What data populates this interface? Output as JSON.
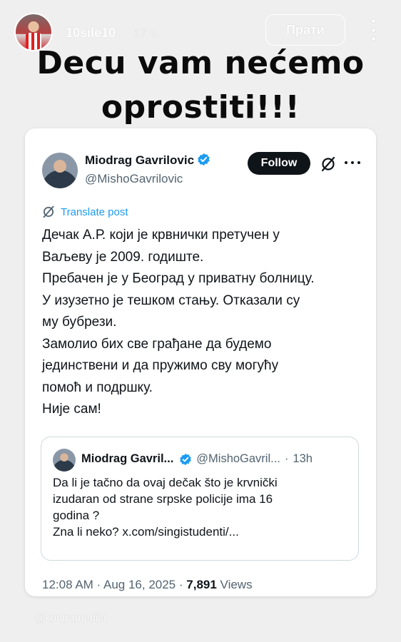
{
  "story": {
    "username": "10sile10",
    "time": "17 ч.",
    "follow_label": "Прати",
    "caption_line1": "Decu vam nećemo",
    "caption_line2": "oprostiti!!!",
    "watermark": "@kontramedija"
  },
  "tweet": {
    "author_name": "Miodrag Gavrilovic",
    "author_handle": "@MishoGavrilovic",
    "follow_label": "Follow",
    "translate_label": "Translate post",
    "body_lines": [
      "Дечак А.Р. који је крвнички претучен у",
      "Ваљеву је 2009. годиште.",
      "Пребачен је у Београд у приватну болницу.",
      "У изузетно је тешком стању. Отказали су",
      "му бубрези.",
      "Замолио бих све грађане да будемо",
      "јединствени и да пружимо сву могућу",
      "помоћ и подршку.",
      "Није сам!"
    ],
    "quote": {
      "name": "Miodrag Gavril...",
      "handle": "@MishoGavril...",
      "separator": "·",
      "time": "13h",
      "text_lines": [
        "Da li je tačno da ovaj dečak što je krvnički",
        "izudaran od strane srpske policije ima 16",
        "godina ?",
        "Zna li neko? x.com/singistudenti/..."
      ]
    },
    "timestamp": "12:08 AM · Aug 16, 2025 ·",
    "views_count": "7,891",
    "views_label": "Views"
  },
  "colors": {
    "accent": "#1d9bf0",
    "text_primary": "#0f1419",
    "text_secondary": "#536471",
    "background": "#efefef"
  },
  "icons": [
    "verified-badge-icon",
    "grok-icon",
    "more-icon",
    "translate-icon",
    "story-more-icon"
  ]
}
